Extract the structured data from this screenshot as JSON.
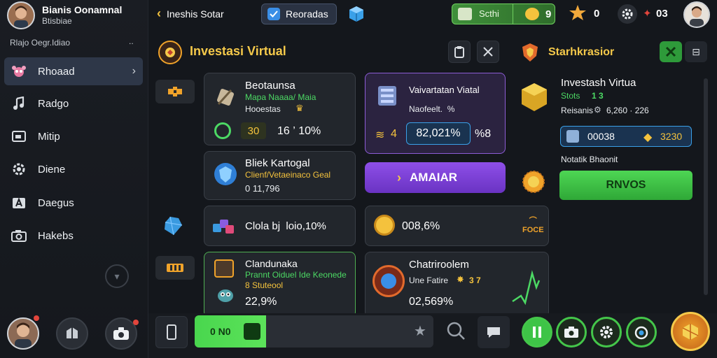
{
  "sidebar": {
    "profile_name": "Bianis Oonamnal",
    "profile_sub": "Btisbiae",
    "section_label": "Rlajo Oegr.Idiao",
    "section_dots": "..",
    "items": [
      {
        "label": "Rhoaad",
        "icon": "crab-icon",
        "active": true
      },
      {
        "label": "Radgo",
        "icon": "music-note-icon"
      },
      {
        "label": "Mitip",
        "icon": "window-icon"
      },
      {
        "label": "Diene",
        "icon": "gear-icon"
      },
      {
        "label": "Daegus",
        "icon": "letter-a-icon"
      },
      {
        "label": "Hakebs",
        "icon": "camera-icon"
      }
    ]
  },
  "topbar": {
    "back_label": "Ineshis Sotar",
    "rewards_label": "Reoradas",
    "currency_label": "Scthi",
    "currency_value": "9",
    "trophy_count": "0",
    "energy_count": "03"
  },
  "panel": {
    "title": "Investasi Virtual",
    "cards": [
      {
        "title": "Beotaunsa",
        "line1": "Mapa Naaaa/ Maia",
        "line2": "Hooestas",
        "value_a": "30",
        "value_b": "16 ’ 10%"
      },
      {
        "title": "Vaivartatan Viatal",
        "line1": "Naofeelt.  %",
        "progress_value": "82,021%",
        "left_val": "4",
        "right_val": "%8"
      },
      {
        "title": "Bliek Kartogal",
        "line1": "Clienf/Vetaeinaco Geal",
        "value": "0 11,796"
      },
      {
        "title": "Clola bj  loio,10%"
      },
      {
        "title": "008,6%",
        "badge": "FOCE"
      },
      {
        "title": "Clandunaka",
        "line1": "Prannt Oiduel Ide Keonede",
        "line2": "8 Stuteool",
        "value": "22,9%"
      },
      {
        "title": "Chatriroolem",
        "line1": "Une Fatire",
        "line1b": "3 7",
        "value": "02,569%"
      }
    ],
    "action_label": "AMAIAR"
  },
  "right": {
    "title": "Starhkrasior",
    "card_title": "Investash Virtua",
    "card_line1": "Stots",
    "card_line1b": "1 3",
    "card_line2": "Reisanis",
    "card_line2b": "6,260 · 226",
    "stat_left": "00038",
    "stat_right": "3230",
    "note": "Notatik Bhaonit",
    "button_label": "RNVOS"
  },
  "bottombar": {
    "search_value": "0 N0",
    "search_progress": 0.3
  },
  "colors": {
    "accent_yellow": "#f5c94a",
    "accent_green": "#4cd964",
    "accent_purple": "#8e4fe8",
    "bg": "#14171c"
  }
}
